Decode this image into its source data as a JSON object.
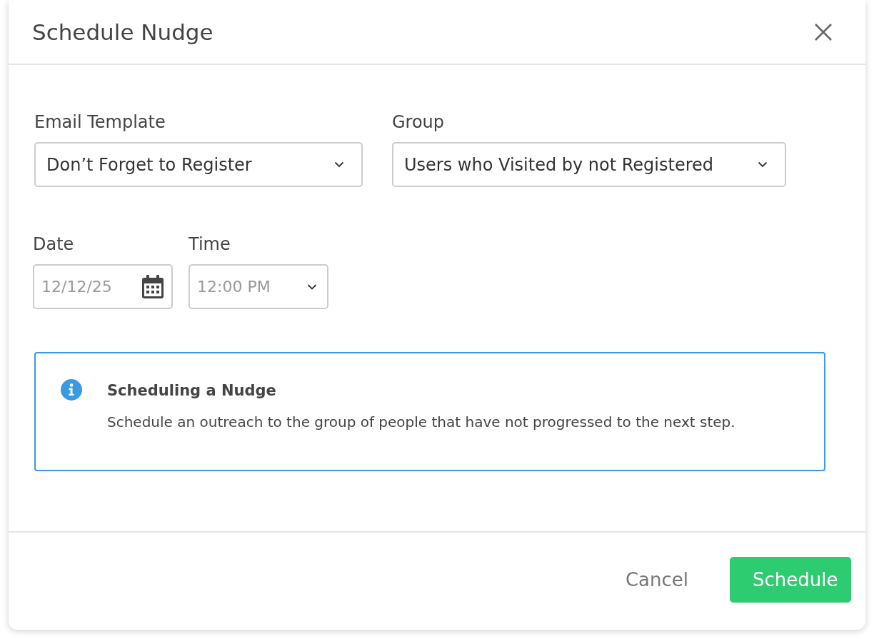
{
  "dialog": {
    "title": "Schedule Nudge"
  },
  "fields": [
    {
      "label": "Email Template",
      "value": "Don’t Forget to Register"
    },
    {
      "label": "Group",
      "value": "Users who Visited by not Registered"
    }
  ],
  "date": {
    "label": "Date",
    "placeholder": "12/12/25"
  },
  "time": {
    "label": "Time",
    "placeholder": "12:00 PM"
  },
  "info": {
    "title": "Scheduling a Nudge",
    "text": "Schedule an outreach to the group of people that have not progressed to the next step."
  },
  "buttons": [
    {
      "label": "Cancel",
      "kind": "secondary"
    },
    {
      "label": "Schedule",
      "kind": "primary"
    }
  ]
}
